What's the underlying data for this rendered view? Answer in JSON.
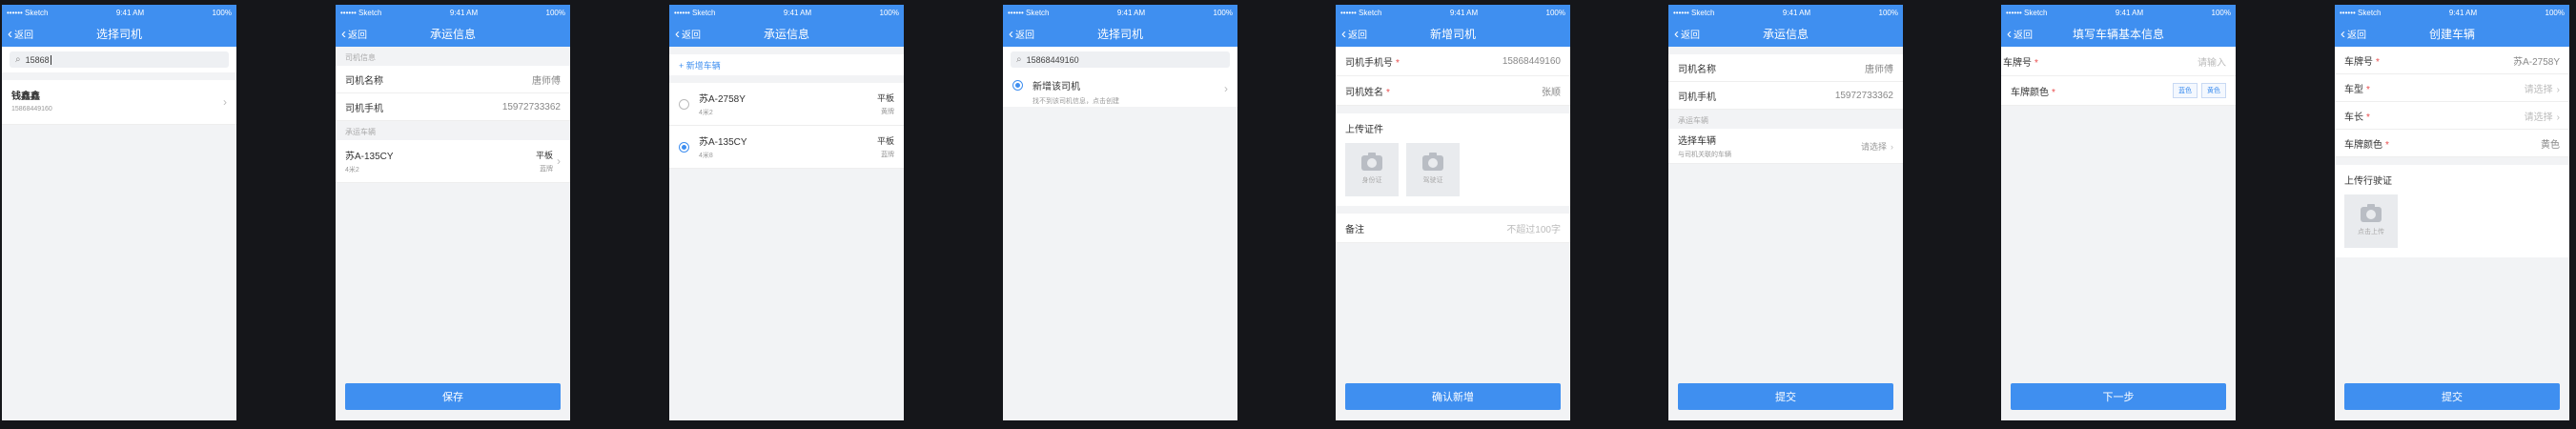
{
  "status_bar": {
    "carrier": "•••••• Sketch",
    "wifi": "≈",
    "time": "9:41 AM",
    "battery": "100%"
  },
  "nav": {
    "back_label": "返回",
    "back_icon": "chevron-left"
  },
  "screen1": {
    "title": "选择司机",
    "search_value": "15868",
    "driver": {
      "name": "钱鑫鑫",
      "phone": "15868449160"
    }
  },
  "screen2": {
    "title": "承运信息",
    "section_driver": "司机信息",
    "driver_name_label": "司机名称",
    "driver_name_value": "唐师傅",
    "driver_phone_label": "司机手机",
    "driver_phone_value": "15972733362",
    "section_vehicle": "承运车辆",
    "vehicle": {
      "plate": "苏A-135CY",
      "sub": "4米2",
      "type": "平板",
      "color": "蓝牌"
    },
    "button": "保存"
  },
  "screen3": {
    "title": "承运信息",
    "add_link": "+ 新增车辆",
    "vehicles": [
      {
        "plate": "苏A-2758Y",
        "sub": "4米2",
        "type": "平板",
        "color": "黄牌",
        "selected": false
      },
      {
        "plate": "苏A-135CY",
        "sub": "4米8",
        "type": "平板",
        "color": "蓝牌",
        "selected": true
      }
    ]
  },
  "screen4": {
    "title": "选择司机",
    "search_value": "15868449160",
    "add_title": "新增该司机",
    "add_sub": "找不到该司机信息，点击创建"
  },
  "screen5": {
    "title": "新增司机",
    "phone_label": "司机手机号",
    "phone_value": "15868449160",
    "name_label": "司机姓名",
    "name_value": "张顺",
    "upload_title": "上传证件",
    "upload_1": "身份证",
    "upload_2": "驾驶证",
    "remark_label": "备注",
    "remark_placeholder": "不超过100字",
    "button": "确认新增"
  },
  "screen6": {
    "title": "承运信息",
    "driver_name_label": "司机名称",
    "driver_name_value": "唐师傅",
    "driver_phone_label": "司机手机",
    "driver_phone_value": "15972733362",
    "section_vehicle": "承运车辆",
    "select_label": "选择车辆",
    "select_sub": "与司机关联的车辆",
    "select_value": "请选择",
    "button": "提交"
  },
  "screen7": {
    "title": "填写车辆基本信息",
    "plate_label": "车牌号",
    "plate_placeholder": "请输入",
    "color_label": "车牌颜色",
    "color_options": [
      "蓝色",
      "黄色"
    ],
    "button": "下一步"
  },
  "screen8": {
    "title": "创建车辆",
    "plate_label": "车牌号",
    "plate_value": "苏A-2758Y",
    "type_label": "车型",
    "type_value": "请选择",
    "length_label": "车长",
    "length_value": "请选择",
    "color_label": "车牌颜色",
    "color_value": "黄色",
    "upload_title": "上传行驶证",
    "upload_label": "点击上传",
    "button": "提交"
  }
}
